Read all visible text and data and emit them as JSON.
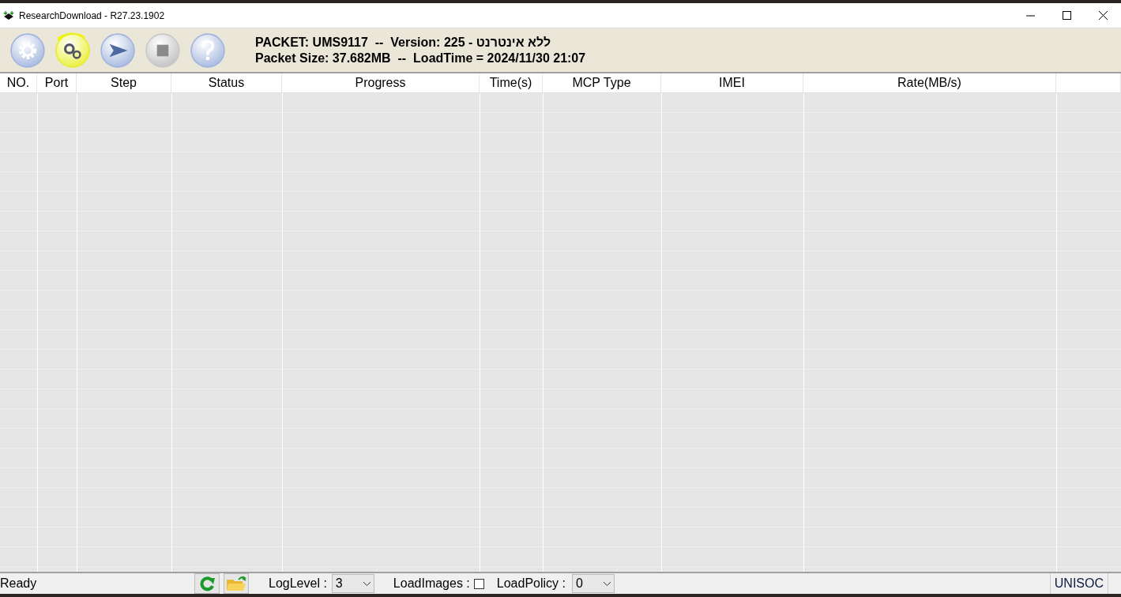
{
  "window": {
    "title": "ResearchDownload - R27.23.1902"
  },
  "toolbar": {
    "buttons": [
      {
        "kind": "settings",
        "highlighted": false
      },
      {
        "kind": "load",
        "highlighted": true
      },
      {
        "kind": "start",
        "highlighted": false
      },
      {
        "kind": "stop",
        "highlighted": false
      },
      {
        "kind": "help",
        "highlighted": false
      }
    ],
    "packet_info": [
      "PACKET: UMS9117  --  Version: 225 - ללא אינטרנט",
      "Packet Size: 37.682MB  --  LoadTime = 2024/11/30 21:07"
    ]
  },
  "table": {
    "columns": [
      "NO.",
      "Port",
      "Step",
      "Status",
      "Progress",
      "Time(s)",
      "MCP Type",
      "IMEI",
      "Rate(MB/s)"
    ]
  },
  "status_bar": {
    "status": "Ready",
    "log_level_label": "LogLevel :",
    "log_level": "3",
    "load_images_label": "LoadImages :",
    "load_images_checked": false,
    "load_policy_label": "LoadPolicy :",
    "load_policy": "0",
    "chip": "UNISOC"
  }
}
